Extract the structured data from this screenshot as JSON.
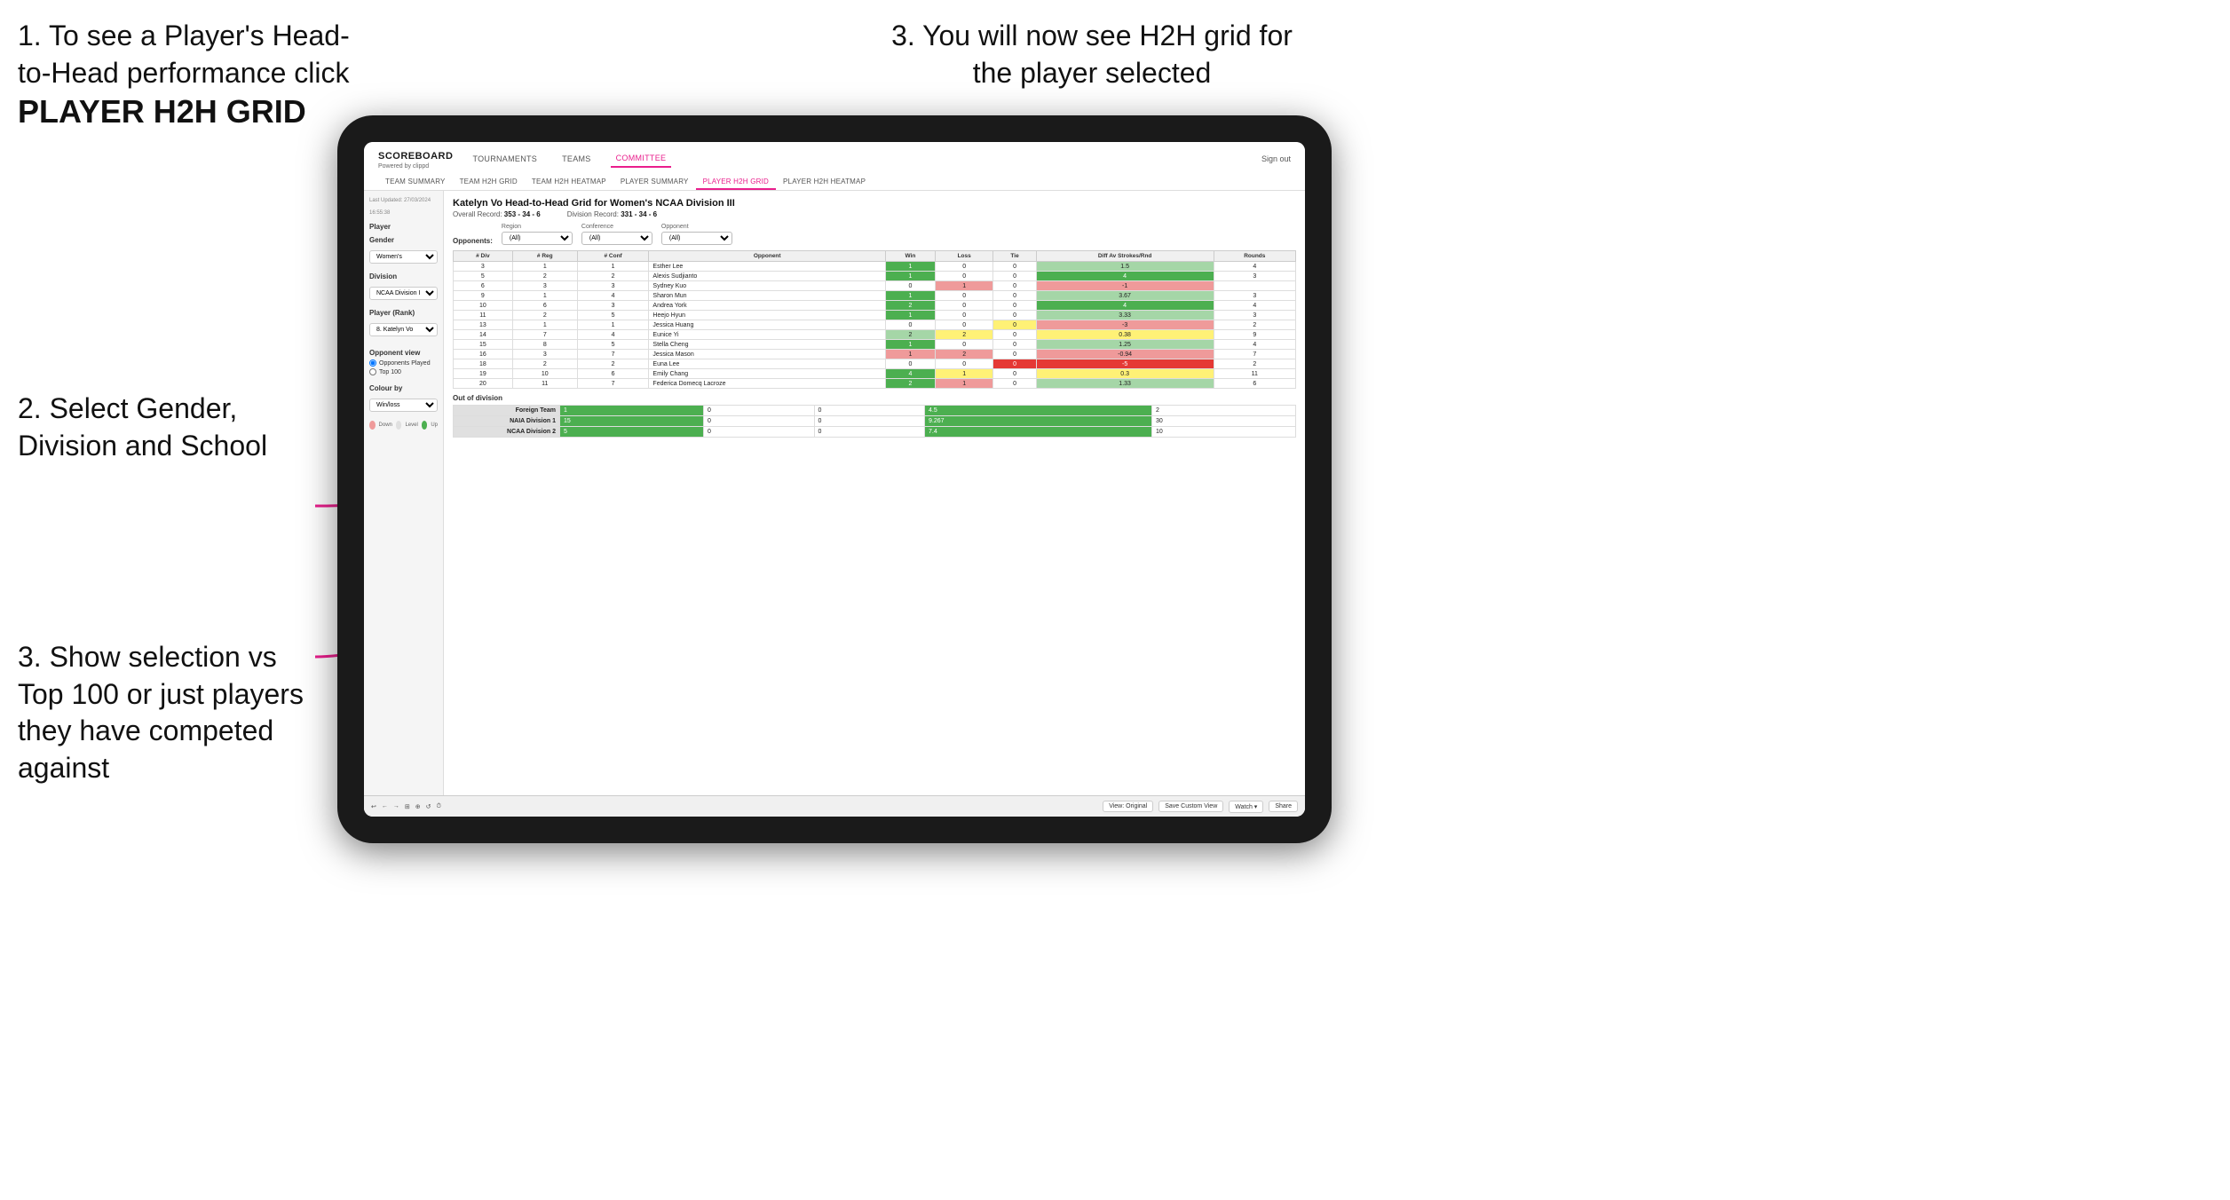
{
  "instructions": {
    "top_left_1": "1. To see a Player's Head-to-Head performance click",
    "top_left_bold": "PLAYER H2H GRID",
    "top_right": "3. You will now see H2H grid for the player selected",
    "mid_left": "2. Select Gender, Division and School",
    "bottom_left_1": "3. Show selection vs Top 100 or just players they have competed against"
  },
  "app": {
    "logo": "SCOREBOARD",
    "logo_sub": "Powered by clippd",
    "nav": [
      "TOURNAMENTS",
      "TEAMS",
      "COMMITTEE"
    ],
    "sign_out": "Sign out",
    "sub_nav": [
      "TEAM SUMMARY",
      "TEAM H2H GRID",
      "TEAM H2H HEATMAP",
      "PLAYER SUMMARY",
      "PLAYER H2H GRID",
      "PLAYER H2H HEATMAP"
    ]
  },
  "sidebar": {
    "timestamp": "Last Updated: 27/03/2024",
    "time": "16:55:38",
    "player_label": "Player",
    "gender_label": "Gender",
    "gender_value": "Women's",
    "division_label": "Division",
    "division_value": "NCAA Division III",
    "player_rank_label": "Player (Rank)",
    "player_rank_value": "8. Katelyn Vo",
    "opponent_view_label": "Opponent view",
    "radio1": "Opponents Played",
    "radio2": "Top 100",
    "colour_by_label": "Colour by",
    "colour_by_value": "Win/loss",
    "colour_down": "Down",
    "colour_level": "Level",
    "colour_up": "Up"
  },
  "grid": {
    "title": "Katelyn Vo Head-to-Head Grid for Women's NCAA Division III",
    "overall_record": "353 - 34 - 6",
    "division_record": "331 - 34 - 6",
    "filters": {
      "region_label": "Region",
      "conference_label": "Conference",
      "opponent_label": "Opponent",
      "opponents_label": "Opponents:",
      "all": "(All)"
    },
    "table_headers": [
      "# Div",
      "# Reg",
      "# Conf",
      "Opponent",
      "Win",
      "Loss",
      "Tie",
      "Diff Av Strokes/Rnd",
      "Rounds"
    ],
    "rows": [
      {
        "div": 3,
        "reg": 1,
        "conf": 1,
        "opponent": "Esther Lee",
        "win": 1,
        "loss": 0,
        "tie": 0,
        "diff": 1.5,
        "rounds": 4,
        "win_color": "green-dark",
        "loss_color": "white",
        "tie_color": "white",
        "diff_color": "green-light"
      },
      {
        "div": 5,
        "reg": 2,
        "conf": 2,
        "opponent": "Alexis Sudjianto",
        "win": 1,
        "loss": 0,
        "tie": 0,
        "diff": 4.0,
        "rounds": 3,
        "win_color": "green-dark",
        "loss_color": "white",
        "tie_color": "white",
        "diff_color": "green-dark"
      },
      {
        "div": 6,
        "reg": 3,
        "conf": 3,
        "opponent": "Sydney Kuo",
        "win": 0,
        "loss": 1,
        "tie": 0,
        "diff": -1.0,
        "rounds": "",
        "win_color": "white",
        "loss_color": "red-light",
        "tie_color": "white",
        "diff_color": "red-light"
      },
      {
        "div": 9,
        "reg": 1,
        "conf": 4,
        "opponent": "Sharon Mun",
        "win": 1,
        "loss": 0,
        "tie": 0,
        "diff": 3.67,
        "rounds": 3,
        "win_color": "green-dark",
        "loss_color": "white",
        "tie_color": "white",
        "diff_color": "green-light"
      },
      {
        "div": 10,
        "reg": 6,
        "conf": 3,
        "opponent": "Andrea York",
        "win": 2,
        "loss": 0,
        "tie": 0,
        "diff": 4.0,
        "rounds": 4,
        "win_color": "green-dark",
        "loss_color": "white",
        "tie_color": "white",
        "diff_color": "green-dark"
      },
      {
        "div": 11,
        "reg": 2,
        "conf": 5,
        "opponent": "Heejo Hyun",
        "win": 1,
        "loss": 0,
        "tie": 0,
        "diff": 3.33,
        "rounds": 3,
        "win_color": "green-dark",
        "loss_color": "white",
        "tie_color": "white",
        "diff_color": "green-light"
      },
      {
        "div": 13,
        "reg": 1,
        "conf": 1,
        "opponent": "Jessica Huang",
        "win": 0,
        "loss": 0,
        "tie": 0,
        "diff": -3.0,
        "rounds": 2,
        "win_color": "white",
        "loss_color": "white",
        "tie_color": "yellow",
        "diff_color": "red-light"
      },
      {
        "div": 14,
        "reg": 7,
        "conf": 4,
        "opponent": "Eunice Yi",
        "win": 2,
        "loss": 2,
        "tie": 0,
        "diff": 0.38,
        "rounds": 9,
        "win_color": "green-light",
        "loss_color": "yellow",
        "tie_color": "white",
        "diff_color": "yellow"
      },
      {
        "div": 15,
        "reg": 8,
        "conf": 5,
        "opponent": "Stella Cheng",
        "win": 1,
        "loss": 0,
        "tie": 0,
        "diff": 1.25,
        "rounds": 4,
        "win_color": "green-dark",
        "loss_color": "white",
        "tie_color": "white",
        "diff_color": "green-light"
      },
      {
        "div": 16,
        "reg": 3,
        "conf": 7,
        "opponent": "Jessica Mason",
        "win": 1,
        "loss": 2,
        "tie": 0,
        "diff": -0.94,
        "rounds": 7,
        "win_color": "red-light",
        "loss_color": "red-light",
        "tie_color": "white",
        "diff_color": "red-light"
      },
      {
        "div": 18,
        "reg": 2,
        "conf": 2,
        "opponent": "Euna Lee",
        "win": 0,
        "loss": 0,
        "tie": 0,
        "diff": -5.0,
        "rounds": 2,
        "win_color": "white",
        "loss_color": "white",
        "tie_color": "red-dark",
        "diff_color": "red-dark"
      },
      {
        "div": 19,
        "reg": 10,
        "conf": 6,
        "opponent": "Emily Chang",
        "win": 4,
        "loss": 1,
        "tie": 0,
        "diff": 0.3,
        "rounds": 11,
        "win_color": "green-dark",
        "loss_color": "yellow",
        "tie_color": "white",
        "diff_color": "yellow"
      },
      {
        "div": 20,
        "reg": 11,
        "conf": 7,
        "opponent": "Federica Domecq Lacroze",
        "win": 2,
        "loss": 1,
        "tie": 0,
        "diff": 1.33,
        "rounds": 6,
        "win_color": "green-dark",
        "loss_color": "red-light",
        "tie_color": "white",
        "diff_color": "green-light"
      }
    ],
    "out_of_division_label": "Out of division",
    "out_of_division_rows": [
      {
        "label": "Foreign Team",
        "win": 1,
        "loss": 0,
        "tie": 0,
        "diff": 4.5,
        "rounds": 2,
        "diff_color": "green-dark"
      },
      {
        "label": "NAIA Division 1",
        "win": 15,
        "loss": 0,
        "tie": 0,
        "diff": 9.267,
        "rounds": 30,
        "diff_color": "green-dark"
      },
      {
        "label": "NCAA Division 2",
        "win": 5,
        "loss": 0,
        "tie": 0,
        "diff": 7.4,
        "rounds": 10,
        "diff_color": "green-dark"
      }
    ]
  },
  "toolbar": {
    "items": [
      "↩",
      "←",
      "→",
      "⊞",
      "⊕",
      "↺",
      "⏱",
      "View: Original",
      "Save Custom View",
      "Watch ▾",
      "⬚",
      "⇶",
      "Share"
    ]
  }
}
